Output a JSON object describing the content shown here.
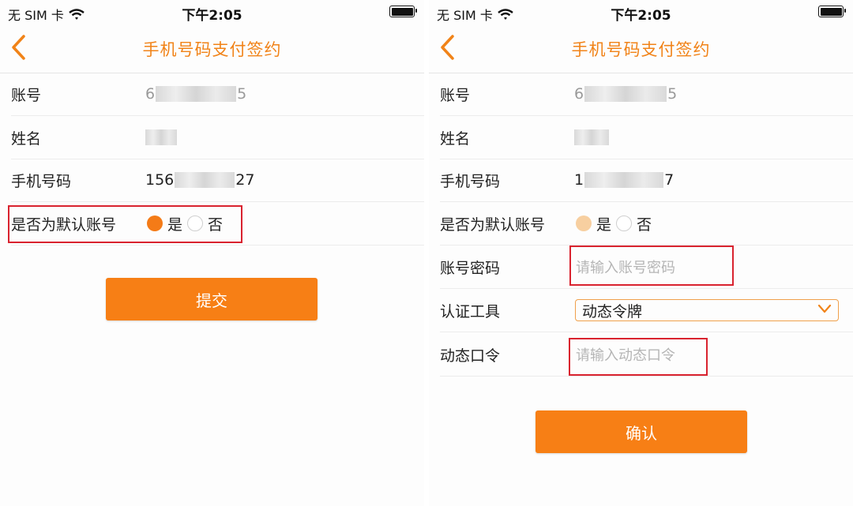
{
  "status_bar": {
    "carrier": "无 SIM 卡",
    "time": "下午2:05"
  },
  "colors": {
    "accent": "#f18318",
    "button": "#f77f15",
    "highlight": "#d9232f"
  },
  "left_screen": {
    "title": "手机号码支付签约",
    "rows": {
      "account_label": "账号",
      "account_prefix": "6",
      "account_suffix": "5",
      "name_label": "姓名",
      "phone_label": "手机号码",
      "phone_prefix": "156",
      "phone_suffix": "27",
      "default_label": "是否为默认账号",
      "yes": "是",
      "no": "否"
    },
    "submit_button": "提交"
  },
  "right_screen": {
    "title": "手机号码支付签约",
    "rows": {
      "account_label": "账号",
      "account_prefix": "6",
      "account_suffix": "5",
      "name_label": "姓名",
      "phone_label": "手机号码",
      "phone_prefix": "1",
      "phone_suffix": "7",
      "default_label": "是否为默认账号",
      "yes": "是",
      "no": "否",
      "password_label": "账号密码",
      "password_placeholder": "请输入账号密码",
      "auth_tool_label": "认证工具",
      "auth_tool_value": "动态令牌",
      "otp_label": "动态口令",
      "otp_placeholder": "请输入动态口令"
    },
    "confirm_button": "确认"
  }
}
